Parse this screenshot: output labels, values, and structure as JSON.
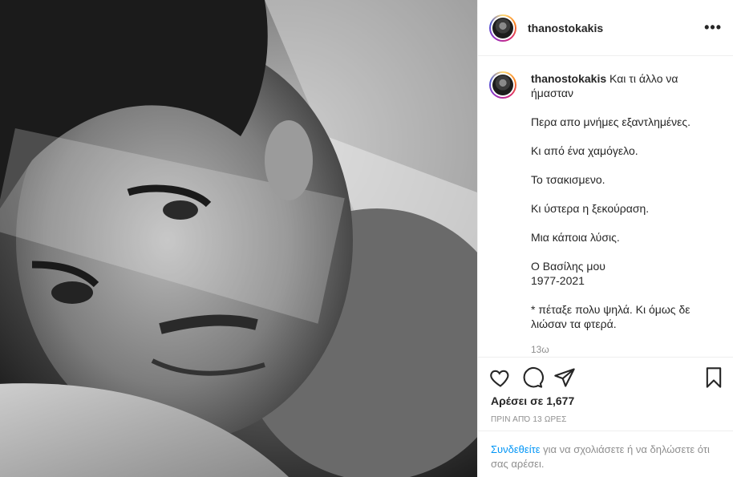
{
  "post": {
    "username": "thanostokakis",
    "more_icon": "ellipsis-icon",
    "caption": {
      "username": "thanostokakis",
      "first_line": "Και τι άλλο να ήμασταν",
      "paragraphs": [
        "Περα απο μνήμες εξαντλημένες.",
        "Κι από ένα χαμόγελο.",
        "Το τσακισμενο.",
        "Κι ύστερα η ξεκούραση.",
        "Μια κάποια λύσις.",
        "Ο Βασίλης μου\n1977-2021",
        "* πέταξε πολυ ψηλά. Κι όμως δε λιώσαν τα φτερά."
      ],
      "time_label": "13ω"
    },
    "likes_text": "Αρέσει σε 1,677",
    "time_ago": "ΠΡΙΝ ΑΠΌ 13 ΩΡΕΣ",
    "login_prompt": {
      "link": "Συνδεθείτε",
      "rest": " για να σχολιάσετε ή να δηλώσετε ότι σας αρέσει."
    }
  }
}
